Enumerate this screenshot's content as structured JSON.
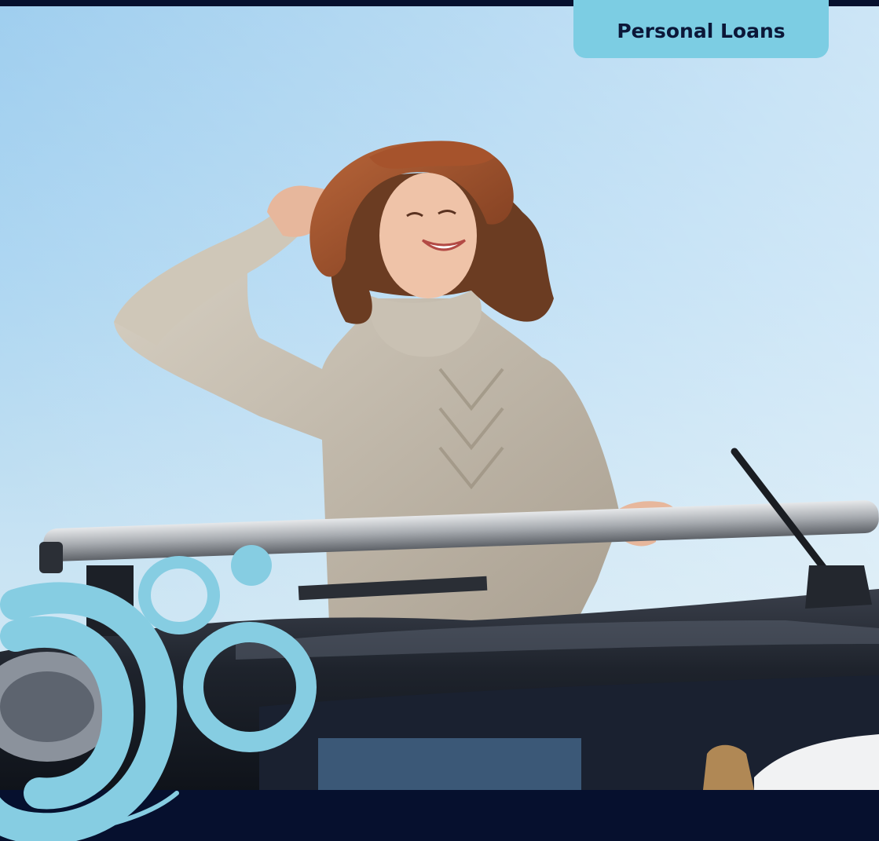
{
  "badge": {
    "label": "Personal Loans"
  },
  "colors": {
    "navy": "#06102e",
    "badge_blue": "#7ccde3",
    "bubble_blue": "#86cde2",
    "sky": "#a9d4f1"
  },
  "photo": {
    "subject": "woman-in-hat-sunroof"
  }
}
